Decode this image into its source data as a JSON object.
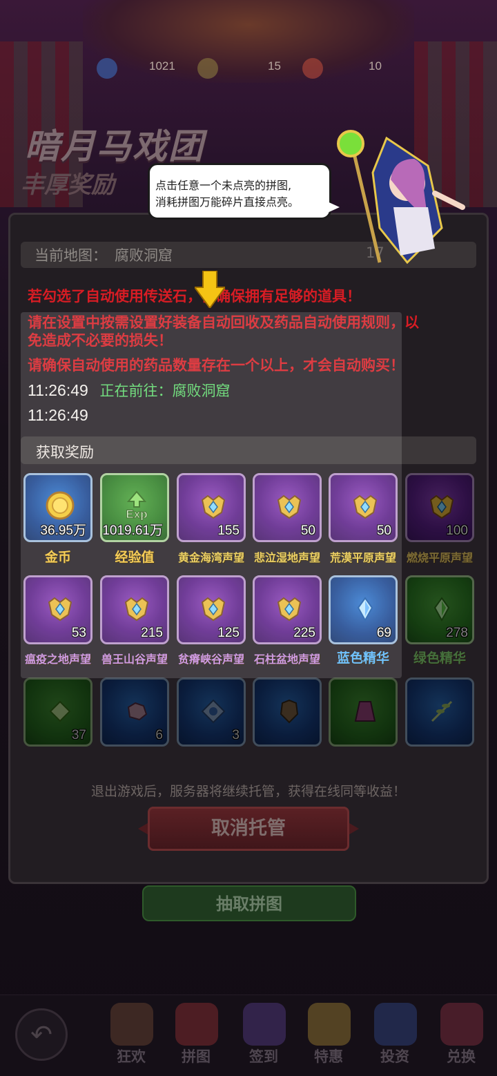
{
  "background": {
    "resources": [
      {
        "name": "gem-icon",
        "value": "1021"
      },
      {
        "name": "puzzle-icon",
        "value": "15"
      },
      {
        "name": "token-icon",
        "value": "10"
      }
    ],
    "title": "暗月马戏团",
    "subtitle": "丰厚奖励",
    "draw_button": "抽取拼图"
  },
  "tutorial": {
    "line1": "点击任意一个未点亮的拼图,",
    "line2": "消耗拼图万能碎片直接点亮。"
  },
  "panel": {
    "map_label": "当前地图：",
    "map_value": "腐败洞窟",
    "timer": "17",
    "log": [
      {
        "type": "warn",
        "text": "若勾选了自动使用传送石，需确保拥有足够的道具！"
      },
      {
        "type": "warn",
        "text": "请在设置中按需设置好装备自动回收及药品自动使用规则，以"
      },
      {
        "type": "warn",
        "text": "免造成不必要的损失！"
      },
      {
        "type": "warn",
        "text": "请确保自动使用的药品数量存在一个以上，才会自动购买！"
      }
    ],
    "entries": [
      {
        "time": "11:26:49",
        "status": "正在前往：腐败洞窟"
      },
      {
        "time": "11:26:49",
        "status": ""
      }
    ],
    "reward_header": "获取奖励",
    "rewards": [
      {
        "name": "金币",
        "qty": "36.95万",
        "color": "blue",
        "icon": "gold-coin-icon"
      },
      {
        "name": "经验值",
        "qty": "1019.61万",
        "color": "green",
        "icon": "exp-icon"
      },
      {
        "name": "黄金海湾声望",
        "qty": "155",
        "color": "purple",
        "icon": "reputation-medal-icon"
      },
      {
        "name": "悲泣湿地声望",
        "qty": "50",
        "color": "purple",
        "icon": "reputation-medal-icon"
      },
      {
        "name": "荒漠平原声望",
        "qty": "50",
        "color": "purple",
        "icon": "reputation-medal-icon"
      },
      {
        "name": "燃烧平原声望",
        "qty": "100",
        "color": "purple",
        "icon": "reputation-medal-icon"
      },
      {
        "name": "瘟疫之地声望",
        "qty": "53",
        "color": "purple",
        "icon": "reputation-medal-icon"
      },
      {
        "name": "兽王山谷声望",
        "qty": "215",
        "color": "purple",
        "icon": "reputation-medal-icon"
      },
      {
        "name": "贫瘠峡谷声望",
        "qty": "125",
        "color": "purple",
        "icon": "reputation-medal-icon"
      },
      {
        "name": "石柱盆地声望",
        "qty": "225",
        "color": "purple",
        "icon": "reputation-medal-icon"
      },
      {
        "name": "蓝色精华",
        "qty": "69",
        "color": "blue",
        "icon": "blue-essence-icon"
      },
      {
        "name": "绿色精华",
        "qty": "278",
        "color": "green",
        "icon": "green-essence-icon"
      },
      {
        "name": "",
        "qty": "37",
        "color": "green",
        "icon": "green-crystal-icon"
      },
      {
        "name": "",
        "qty": "6",
        "color": "blue",
        "icon": "ore-icon"
      },
      {
        "name": "",
        "qty": "3",
        "color": "blue",
        "icon": "rune-icon"
      },
      {
        "name": "",
        "qty": "",
        "color": "blue",
        "icon": "armor-icon"
      },
      {
        "name": "",
        "qty": "",
        "color": "green",
        "icon": "robe-icon"
      },
      {
        "name": "",
        "qty": "",
        "color": "blue",
        "icon": "herb-branch-icon"
      }
    ],
    "notice": "退出游戏后，服务器将继续托管，获得在线同等收益！",
    "cancel_button": "取消托管"
  },
  "nav": [
    {
      "label": "狂欢",
      "icon": "ferris-wheel-icon"
    },
    {
      "label": "拼图",
      "icon": "clown-icon"
    },
    {
      "label": "签到",
      "icon": "jester-box-icon"
    },
    {
      "label": "特惠",
      "icon": "balloon-gift-icon"
    },
    {
      "label": "投资",
      "icon": "card-icon"
    },
    {
      "label": "兑换",
      "icon": "circus-tent-icon"
    }
  ],
  "colors": {
    "warn": "#d81c24",
    "going": "#5dd86a",
    "reward_gold": "#e8c84a",
    "reward_purple": "#c78be0"
  }
}
